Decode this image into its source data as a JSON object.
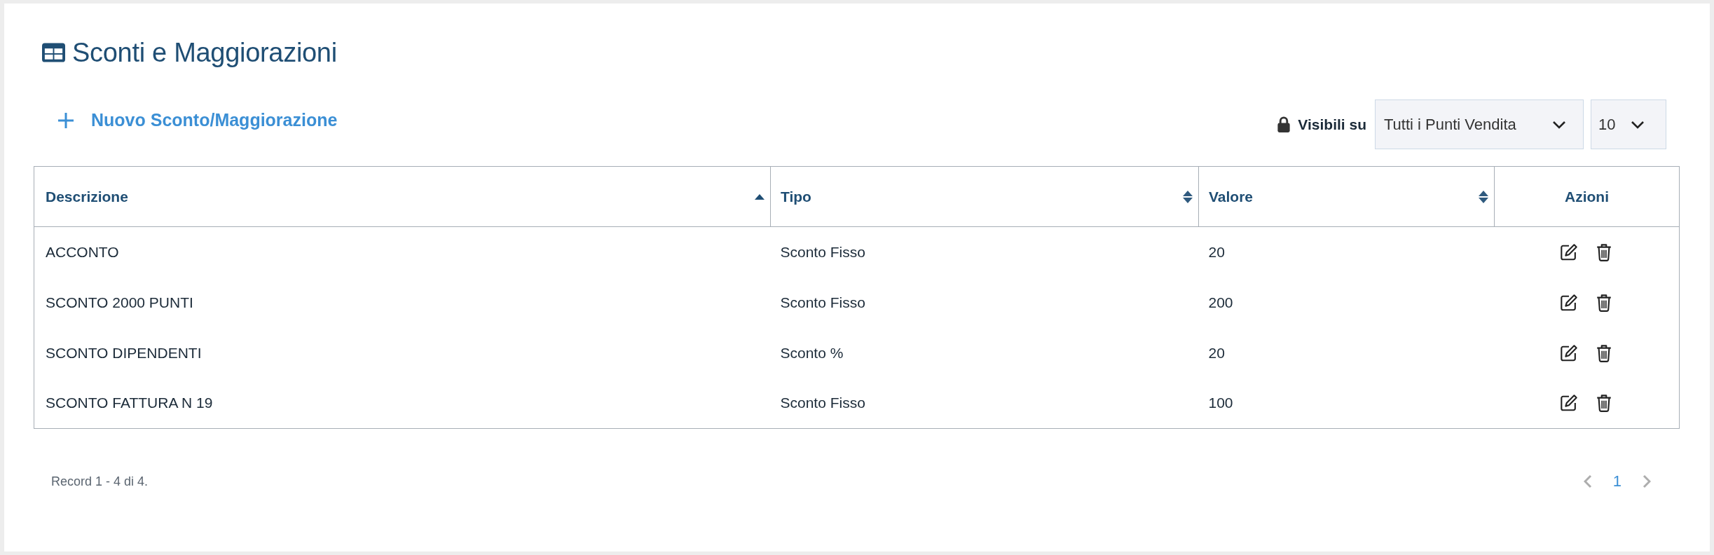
{
  "page": {
    "title": "Sconti e Maggiorazioni"
  },
  "toolbar": {
    "new_button": {
      "label": "Nuovo Sconto/Maggiorazione"
    },
    "visibility_label": "Visibili su",
    "store_select": {
      "value": "Tutti i Punti Vendita"
    },
    "page_size_select": {
      "value": "10"
    }
  },
  "table": {
    "columns": [
      {
        "label": "Descrizione",
        "kind": "data",
        "sorted": true
      },
      {
        "label": "Tipo",
        "kind": "data",
        "sorted": false
      },
      {
        "label": "Valore",
        "kind": "data",
        "sorted": false
      },
      {
        "label": "Azioni",
        "kind": "actions",
        "sorted": false
      }
    ],
    "rows": [
      {
        "cells": [
          "ACCONTO",
          "Sconto Fisso",
          "20"
        ]
      },
      {
        "cells": [
          "SCONTO 2000 PUNTI",
          "Sconto Fisso",
          "200"
        ]
      },
      {
        "cells": [
          "SCONTO DIPENDENTI",
          "Sconto %",
          "20"
        ]
      },
      {
        "cells": [
          "SCONTO FATTURA N 19",
          "Sconto Fisso",
          "100"
        ]
      }
    ]
  },
  "footer": {
    "record_info": "Record 1 - 4 di 4."
  },
  "pagination": {
    "previous": {
      "disabled": true
    },
    "pages": [
      {
        "label": "1",
        "selected": true
      }
    ],
    "next": {
      "disabled": true
    }
  }
}
